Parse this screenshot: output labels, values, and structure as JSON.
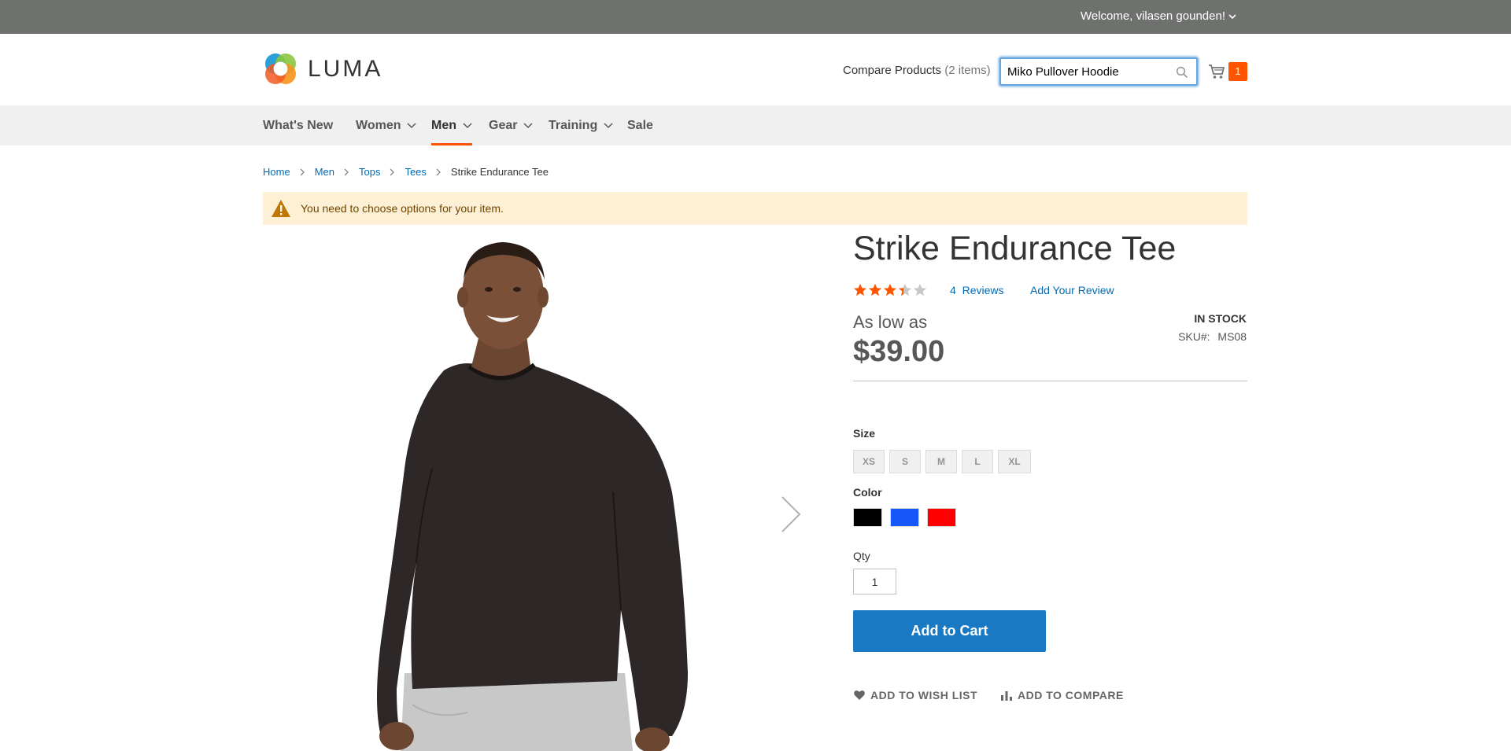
{
  "top_panel": {
    "welcome": "Welcome, vilasen gounden!"
  },
  "header": {
    "logo_text": "LUMA",
    "compare_label": "Compare Products",
    "compare_count": "(2 items)",
    "search_value": "Miko Pullover Hoodie",
    "cart_count": "1"
  },
  "nav": {
    "items": [
      {
        "label": "What's New"
      },
      {
        "label": "Women"
      },
      {
        "label": "Men"
      },
      {
        "label": "Gear"
      },
      {
        "label": "Training"
      },
      {
        "label": "Sale"
      }
    ]
  },
  "breadcrumb": {
    "items": [
      "Home",
      "Men",
      "Tops",
      "Tees"
    ],
    "current": "Strike Endurance Tee"
  },
  "message": {
    "text": "You need to choose options for your item."
  },
  "product": {
    "title": "Strike Endurance Tee",
    "rating_stars": 3,
    "rating_max": 5,
    "reviews_count": "4",
    "reviews_label": "Reviews",
    "add_review": "Add Your Review",
    "as_low_as": "As low as",
    "price": "$39.00",
    "stock": "In stock",
    "sku_label": "SKU#:",
    "sku_value": "MS08",
    "size_label": "Size",
    "sizes": [
      "XS",
      "S",
      "M",
      "L",
      "XL"
    ],
    "color_label": "Color",
    "colors": [
      "#000000",
      "#1857f7",
      "#ff0000"
    ],
    "qty_label": "Qty",
    "qty_value": "1",
    "add_to_cart": "Add to Cart",
    "wishlist": "Add to Wish List",
    "compare": "Add to Compare"
  },
  "colors": {
    "accent": "#ff5501",
    "link": "#006bb4",
    "primary_button": "#1979c3"
  }
}
